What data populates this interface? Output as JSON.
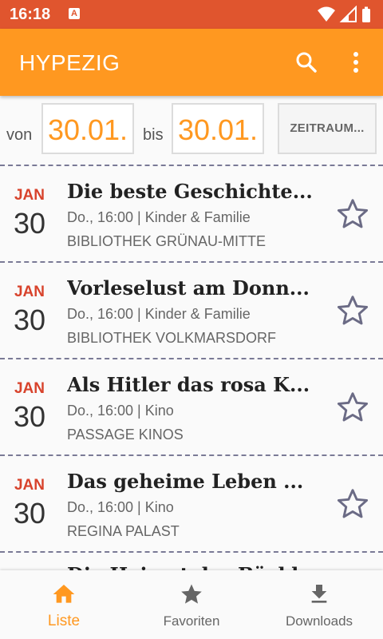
{
  "status_bar": {
    "time": "16:18",
    "notification_letter": "A"
  },
  "app_bar": {
    "title": "HYPEZIG",
    "icons": [
      "search-icon",
      "more-vert-icon"
    ]
  },
  "filter": {
    "from_label": "von",
    "from_date": "30.01.",
    "to_label": "bis",
    "to_date": "30.01.",
    "range_button": "ZEITRAUM..."
  },
  "events": [
    {
      "month": "JAN",
      "day": "30",
      "title": "Die beste Geschichte...",
      "meta": "Do., 16:00 | Kinder & Familie",
      "venue": "BIBLIOTHEK GRÜNAU-MITTE",
      "favorite": false
    },
    {
      "month": "JAN",
      "day": "30",
      "title": "Vorleselust am Donn...",
      "meta": "Do., 16:00 | Kinder & Familie",
      "venue": "BIBLIOTHEK VOLKMARSDORF",
      "favorite": false
    },
    {
      "month": "JAN",
      "day": "30",
      "title": "Als Hitler das rosa K...",
      "meta": "Do., 16:00 | Kino",
      "venue": "PASSAGE KINOS",
      "favorite": false
    },
    {
      "month": "JAN",
      "day": "30",
      "title": "Das geheime Leben ...",
      "meta": "Do., 16:00 | Kino",
      "venue": "REGINA PALAST",
      "favorite": false
    }
  ],
  "partial_event_title": "Die Heimat der Bäckl",
  "bottom_nav": {
    "items": [
      {
        "label": "Liste",
        "icon": "home-icon",
        "active": true
      },
      {
        "label": "Favoriten",
        "icon": "star-icon",
        "active": false
      },
      {
        "label": "Downloads",
        "icon": "download-icon",
        "active": false
      }
    ]
  },
  "colors": {
    "status_bar": "#e0552e",
    "app_bar": "#ff9820",
    "accent": "#ff9820",
    "month": "#d8432c"
  }
}
